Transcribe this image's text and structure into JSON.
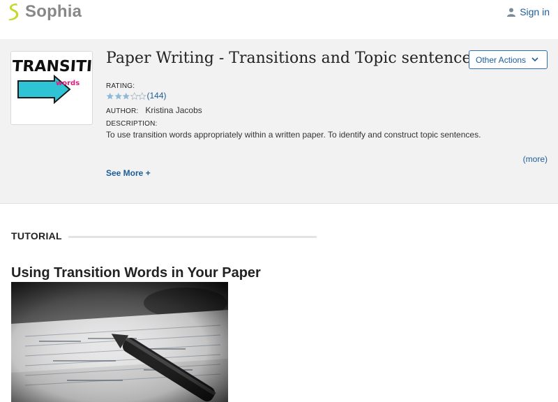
{
  "header": {
    "logo_text": "Sophia",
    "signin_label": "Sign in"
  },
  "overview": {
    "thumbnail_text_main": "Transition",
    "thumbnail_text_sub": "words",
    "title": "Paper Writing - Transitions and Topic sentences",
    "other_actions_label": "Other Actions",
    "rating_label": "RATING:",
    "rating_stars": 3,
    "rating_max": 5,
    "rating_count": "(144)",
    "author_label": "AUTHOR:",
    "author_name": "Kristina Jacobs",
    "description_label": "DESCRIPTION:",
    "description": "To use transition words appropriately within a written paper. To identify and construct topic sentences.",
    "more_label": "(more)",
    "see_more_label": "See More +"
  },
  "tutorial": {
    "section_label": "TUTORIAL",
    "heading": "Using Transition Words in Your Paper"
  },
  "colors": {
    "brand_green": "#c6d82b",
    "link_blue": "#1d5c9a",
    "star_filled": "#8fb9d9",
    "panel_bg": "#f2f2f2"
  }
}
